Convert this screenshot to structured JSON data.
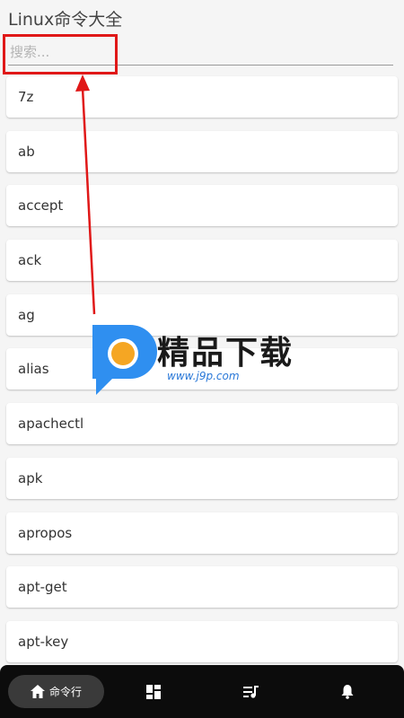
{
  "app": {
    "title": "Linux命令大全"
  },
  "search": {
    "placeholder": "搜索..."
  },
  "commands": [
    "7z",
    "ab",
    "accept",
    "ack",
    "ag",
    "alias",
    "apachectl",
    "apk",
    "apropos",
    "apt-get",
    "apt-key"
  ],
  "watermark": {
    "brand": "精品下载",
    "url": "www.j9p.com"
  },
  "bottom_nav": {
    "items": [
      {
        "icon": "home-icon",
        "label": "命令行",
        "active": true
      },
      {
        "icon": "dashboard-icon",
        "label": "",
        "active": false
      },
      {
        "icon": "playlist-music-icon",
        "label": "",
        "active": false
      },
      {
        "icon": "bell-icon",
        "label": "",
        "active": false
      }
    ]
  },
  "colors": {
    "accent_annotation": "#e01818",
    "nav_bg": "#0c0c0c",
    "nav_active_bg": "#3a3a3a"
  }
}
